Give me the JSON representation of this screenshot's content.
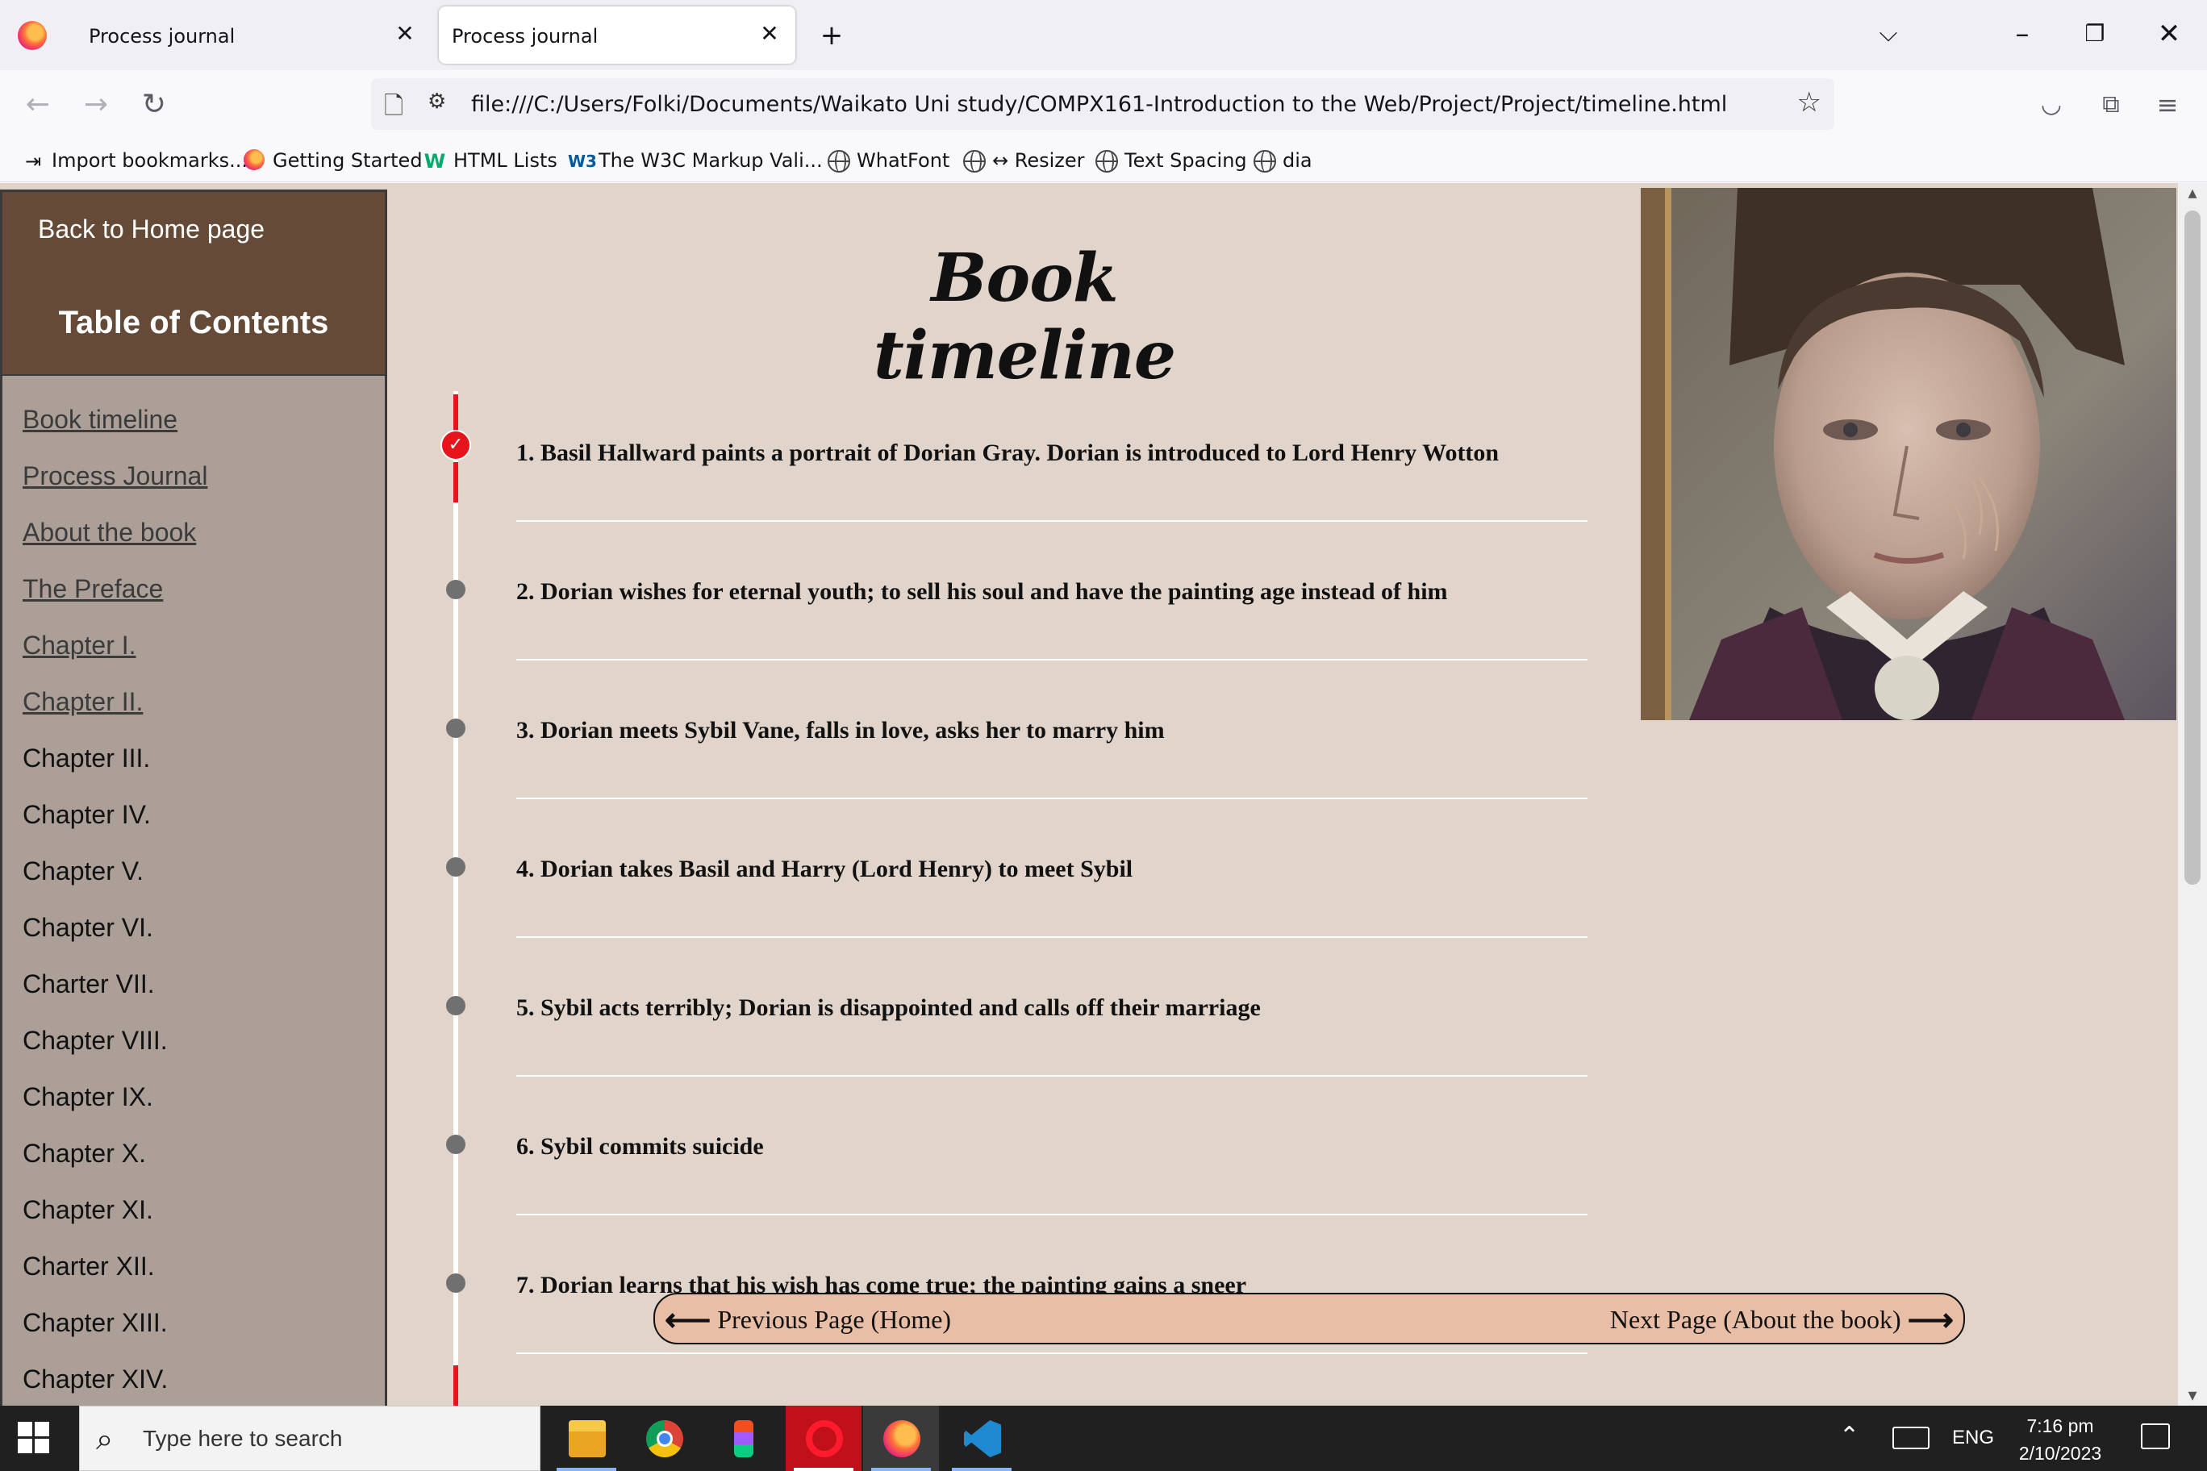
{
  "browser": {
    "tabs": [
      {
        "title": "Process journal",
        "active": false
      },
      {
        "title": "Process journal",
        "active": true
      }
    ],
    "new_tab_glyph": "+",
    "close_glyph": "✕",
    "url": "file:///C:/Users/Folki/Documents/Waikato Uni study/COMPX161-Introduction to the Web/Project/Project/timeline.html",
    "bookmarks": [
      {
        "label": "Import bookmarks...",
        "icon": "import-icon"
      },
      {
        "label": "Getting Started",
        "icon": "firefox-icon"
      },
      {
        "label": "HTML Lists",
        "icon": "w3schools-icon"
      },
      {
        "label": "The W3C Markup Vali...",
        "icon": "w3c-icon"
      },
      {
        "label": "WhatFont",
        "icon": "globe-icon"
      },
      {
        "label": "↔ Resizer",
        "icon": "globe-icon"
      },
      {
        "label": "Text Spacing",
        "icon": "globe-icon"
      },
      {
        "label": "dia",
        "icon": "globe-icon"
      }
    ]
  },
  "sidebar": {
    "home_link": "Back to Home page",
    "toc_title": "Table of Contents",
    "items": [
      {
        "label": "Book timeline",
        "linked": true
      },
      {
        "label": "Process Journal",
        "linked": true
      },
      {
        "label": "About the book",
        "linked": true
      },
      {
        "label": "The Preface",
        "linked": true
      },
      {
        "label": "Chapter I.",
        "linked": true
      },
      {
        "label": "Chapter II.",
        "linked": true
      },
      {
        "label": "Chapter III.",
        "linked": false
      },
      {
        "label": "Chapter IV.",
        "linked": false
      },
      {
        "label": "Chapter V.",
        "linked": false
      },
      {
        "label": "Chapter VI.",
        "linked": false
      },
      {
        "label": "Charter VII.",
        "linked": false
      },
      {
        "label": "Chapter VIII.",
        "linked": false
      },
      {
        "label": "Chapter IX.",
        "linked": false
      },
      {
        "label": "Chapter X.",
        "linked": false
      },
      {
        "label": "Chapter XI.",
        "linked": false
      },
      {
        "label": "Charter XII.",
        "linked": false
      },
      {
        "label": "Chapter XIII.",
        "linked": false
      },
      {
        "label": "Chapter XIV.",
        "linked": false
      }
    ]
  },
  "main": {
    "title": "Book timeline",
    "events": [
      {
        "text": "1. Basil Hallward paints a portrait of Dorian Gray. Dorian is introduced to Lord Henry Wotton",
        "done": true
      },
      {
        "text": "2. Dorian wishes for eternal youth; to sell his soul and have the painting age instead of him",
        "done": false
      },
      {
        "text": "3. Dorian meets Sybil Vane, falls in love, asks her to marry him",
        "done": false
      },
      {
        "text": "4. Dorian takes Basil and Harry (Lord Henry) to meet Sybil",
        "done": false
      },
      {
        "text": "5. Sybil acts terribly; Dorian is disappointed and calls off their marriage",
        "done": false
      },
      {
        "text": "6. Sybil commits suicide",
        "done": false
      },
      {
        "text": "7. Dorian learns that his wish has come true; the painting gains a sneer",
        "done": false
      }
    ],
    "pager": {
      "prev_label": "Previous Page (Home)",
      "next_label": "Next Page (About the book)"
    }
  },
  "taskbar": {
    "search_placeholder": "Type here to search",
    "language": "ENG",
    "time": "7:16 pm",
    "date": "2/10/2023",
    "apps": [
      "file-explorer-icon",
      "chrome-icon",
      "figma-icon",
      "opera-icon",
      "firefox-icon",
      "vscode-icon"
    ]
  },
  "colors": {
    "page_bg": "#e1d4cb",
    "sidebar_bg": "#ab9f98",
    "sidebar_head_bg": "#654a37",
    "timeline_accent": "#e8141c",
    "pager_bg": "#e8bfa6"
  }
}
